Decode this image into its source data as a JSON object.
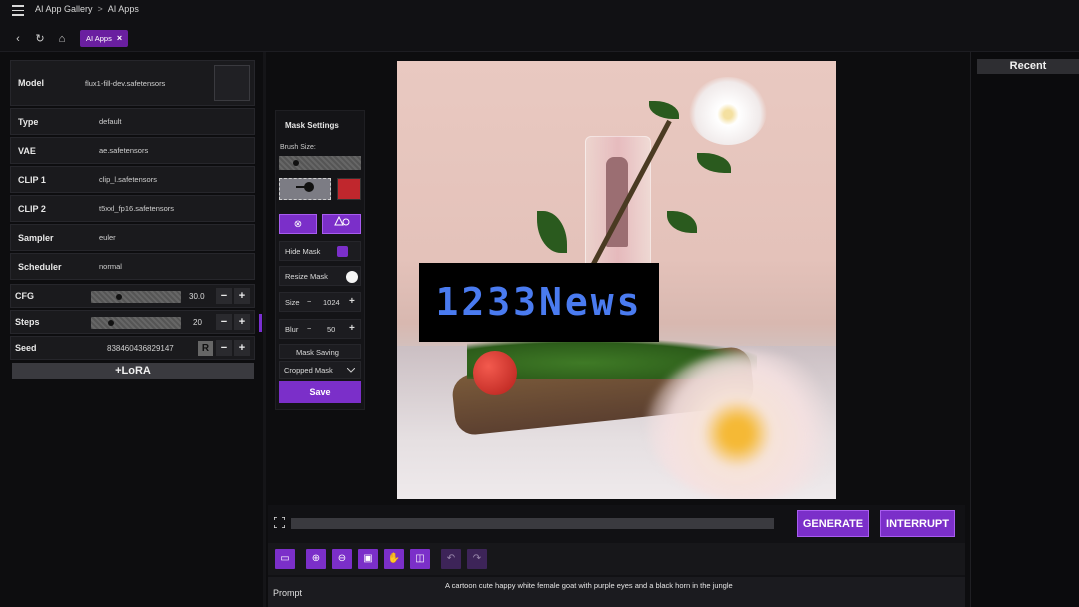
{
  "breadcrumb": {
    "root": "AI App Gallery",
    "sep": ">",
    "current": "AI Apps"
  },
  "tab": {
    "label": "AI Apps",
    "close": "×"
  },
  "nav": {
    "back": "‹",
    "reload": "↻",
    "home": "⌂"
  },
  "settings": {
    "model": {
      "label": "Model",
      "value": "flux1-fill-dev.safetensors"
    },
    "type": {
      "label": "Type",
      "value": "default"
    },
    "vae": {
      "label": "VAE",
      "value": "ae.safetensors"
    },
    "clip1": {
      "label": "CLIP 1",
      "value": "clip_l.safetensors"
    },
    "clip2": {
      "label": "CLIP 2",
      "value": "t5xxl_fp16.safetensors"
    },
    "sampler": {
      "label": "Sampler",
      "value": "euler"
    },
    "scheduler": {
      "label": "Scheduler",
      "value": "normal"
    },
    "cfg": {
      "label": "CFG",
      "value": "30.0",
      "fraction": 0.3
    },
    "steps": {
      "label": "Steps",
      "value": "20",
      "fraction": 0.2
    },
    "seed": {
      "label": "Seed",
      "value": "838460436829147",
      "random_label": "R"
    },
    "minus": "−",
    "plus": "+",
    "lora_label": "+LoRA"
  },
  "mask": {
    "title": "Mask Settings",
    "brush_size_label": "Brush Size:",
    "brush_color": "#c0272d",
    "clear_icon": "⊗",
    "hide_mask": "Hide Mask",
    "resize_mask": "Resize Mask",
    "size_label": "Size",
    "size_value": "1024",
    "blur_label": "Blur",
    "blur_value": "50",
    "saving_label": "Mask Saving",
    "saving_option": "Cropped Mask",
    "save_label": "Save"
  },
  "canvas": {
    "watermark": "1233News"
  },
  "recent": {
    "label": "Recent"
  },
  "actions": {
    "generate": "GENERATE",
    "interrupt": "INTERRUPT"
  },
  "prompt": {
    "label": "Prompt",
    "text": "A cartoon cute happy white female goat with purple eyes and a black horn in the jungle"
  },
  "colors": {
    "accent": "#7b2fc9",
    "background": "#0d0d0f"
  }
}
